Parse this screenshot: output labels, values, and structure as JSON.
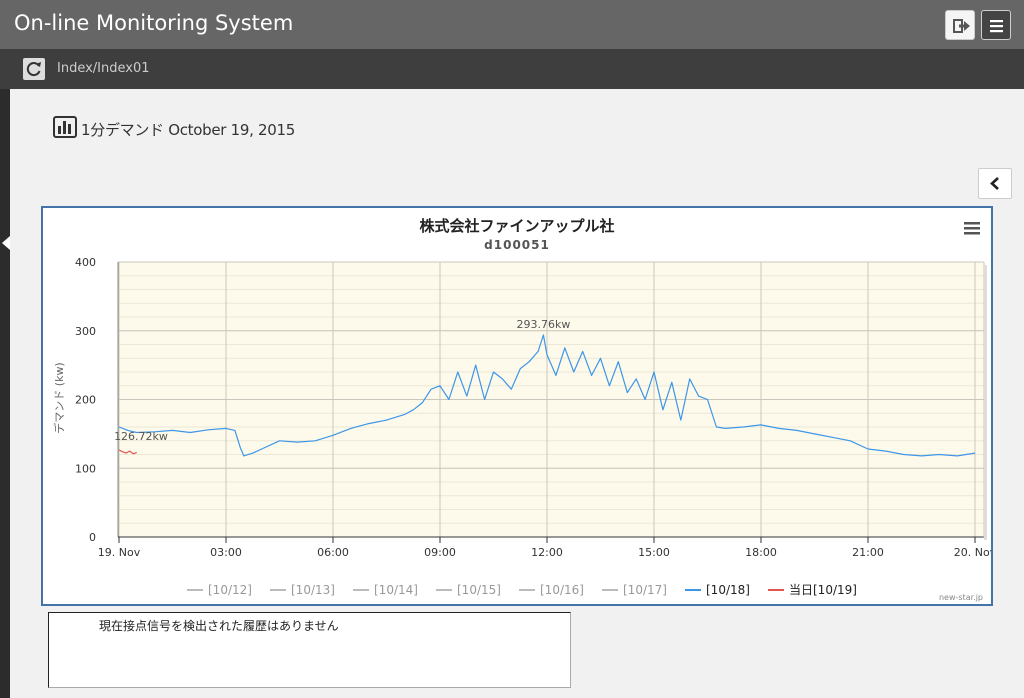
{
  "app": {
    "title": "On-line Monitoring System",
    "breadcrumb": "Index/Index01"
  },
  "toolbar": {
    "exit_icon": "sign-out-icon",
    "menu_icon": "hamburger-icon",
    "refresh_icon": "refresh-icon"
  },
  "page": {
    "heading_icon": "bar-chart-icon",
    "heading": "1分デマンド October 19, 2015",
    "collapse_icon": "chevron-left-icon"
  },
  "log": {
    "message": "現在接点信号を検出された履歴はありません"
  },
  "colors": {
    "accent": "#4572a7",
    "series_blue": "#3d96e8",
    "series_red": "#e0554e",
    "plot_bg": "#fdfaeb"
  },
  "chart_data": {
    "type": "line",
    "title": "株式会社ファインアップル社",
    "subtitle": "d100051",
    "xlabel": "",
    "ylabel": "デマンド (kw)",
    "xlim": [
      0,
      24
    ],
    "ylim": [
      0,
      400
    ],
    "x_ticks": [
      "19. Nov",
      "03:00",
      "06:00",
      "09:00",
      "12:00",
      "15:00",
      "18:00",
      "21:00",
      "20. Nov"
    ],
    "y_ticks": [
      "0",
      "100",
      "200",
      "300",
      "400"
    ],
    "grid": true,
    "legend_position": "bottom",
    "credits": "new-star.jp",
    "legend": [
      {
        "name": "[10/12]",
        "color": "#aaaaaa",
        "active": false
      },
      {
        "name": "[10/13]",
        "color": "#aaaaaa",
        "active": false
      },
      {
        "name": "[10/14]",
        "color": "#aaaaaa",
        "active": false
      },
      {
        "name": "[10/15]",
        "color": "#aaaaaa",
        "active": false
      },
      {
        "name": "[10/16]",
        "color": "#aaaaaa",
        "active": false
      },
      {
        "name": "[10/17]",
        "color": "#aaaaaa",
        "active": false
      },
      {
        "name": "[10/18]",
        "color": "#3d96e8",
        "active": true
      },
      {
        "name": "当日[10/19]",
        "color": "#e0554e",
        "active": true
      }
    ],
    "series": [
      {
        "name": "[10/18]",
        "color": "#3d96e8",
        "x": [
          0,
          0.25,
          0.5,
          1,
          1.5,
          2,
          2.5,
          3,
          3.25,
          3.4,
          3.5,
          3.75,
          4,
          4.5,
          5,
          5.5,
          6,
          6.5,
          7,
          7.5,
          8,
          8.25,
          8.5,
          8.75,
          9,
          9.25,
          9.5,
          9.75,
          10,
          10.25,
          10.5,
          10.75,
          11,
          11.25,
          11.5,
          11.75,
          11.9,
          12,
          12.25,
          12.5,
          12.75,
          13,
          13.25,
          13.5,
          13.75,
          14,
          14.25,
          14.5,
          14.75,
          15,
          15.25,
          15.5,
          15.75,
          16,
          16.25,
          16.5,
          16.75,
          17,
          17.5,
          18,
          18.5,
          19,
          19.5,
          20,
          20.5,
          21,
          21.5,
          22,
          22.5,
          23,
          23.5,
          24
        ],
        "values": [
          160,
          155,
          152,
          153,
          155,
          152,
          156,
          158,
          155,
          130,
          118,
          122,
          128,
          140,
          138,
          140,
          148,
          158,
          165,
          170,
          178,
          185,
          195,
          215,
          220,
          200,
          240,
          205,
          250,
          200,
          240,
          230,
          215,
          245,
          255,
          270,
          293.76,
          265,
          235,
          275,
          240,
          270,
          235,
          260,
          220,
          255,
          210,
          230,
          200,
          240,
          185,
          225,
          170,
          230,
          205,
          200,
          160,
          158,
          160,
          163,
          158,
          155,
          150,
          145,
          140,
          128,
          125,
          120,
          118,
          120,
          118,
          122
        ]
      },
      {
        "name": "当日[10/19]",
        "color": "#e0554e",
        "x": [
          0,
          0.1,
          0.2,
          0.3,
          0.4,
          0.5
        ],
        "values": [
          126.72,
          124,
          122,
          125,
          121,
          123
        ]
      }
    ],
    "annotations": [
      {
        "text": "293.76kw",
        "x": 11.9,
        "y": 293.76
      },
      {
        "text": "126.72kw",
        "x": 0,
        "y": 126.72
      }
    ]
  }
}
